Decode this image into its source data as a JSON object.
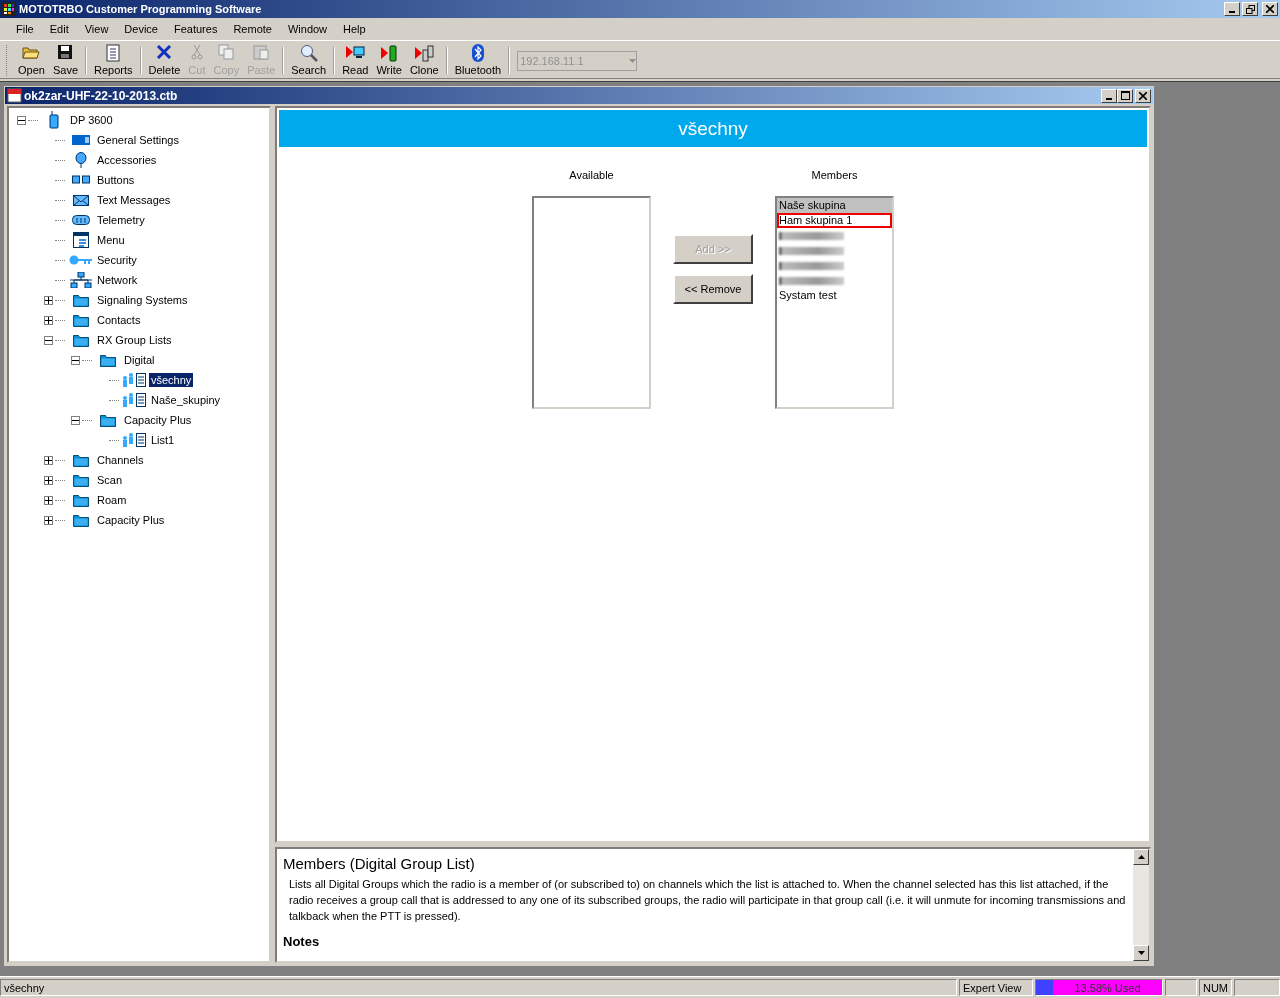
{
  "window": {
    "title": "MOTOTRBO Customer Programming Software"
  },
  "menu": [
    "File",
    "Edit",
    "View",
    "Device",
    "Features",
    "Remote",
    "Window",
    "Help"
  ],
  "toolbar": [
    {
      "kind": "open",
      "label": "Open",
      "disabled": false
    },
    {
      "kind": "save",
      "label": "Save",
      "disabled": false
    },
    {
      "kind": "reports",
      "label": "Reports",
      "disabled": false
    },
    {
      "kind": "delete",
      "label": "Delete",
      "disabled": false
    },
    {
      "kind": "cut",
      "label": "Cut",
      "disabled": true
    },
    {
      "kind": "copy",
      "label": "Copy",
      "disabled": true
    },
    {
      "kind": "paste",
      "label": "Paste",
      "disabled": true
    },
    {
      "kind": "search",
      "label": "Search",
      "disabled": false
    },
    {
      "kind": "read",
      "label": "Read",
      "disabled": false
    },
    {
      "kind": "write",
      "label": "Write",
      "disabled": false
    },
    {
      "kind": "clone",
      "label": "Clone",
      "disabled": false
    },
    {
      "kind": "bluetooth",
      "label": "Bluetooth",
      "disabled": false
    }
  ],
  "address_field": {
    "value": "192.168.11.1",
    "disabled": true
  },
  "document": {
    "title": "ok2zar-UHF-22-10-2013.ctb"
  },
  "tree": [
    {
      "kind": "radio",
      "label": "DP 3600",
      "expanded": true,
      "selected": false,
      "children": [
        {
          "kind": "settings",
          "label": "General Settings",
          "selected": false
        },
        {
          "kind": "accessories",
          "label": "Accessories",
          "selected": false
        },
        {
          "kind": "buttons",
          "label": "Buttons",
          "selected": false
        },
        {
          "kind": "messages",
          "label": "Text Messages",
          "selected": false
        },
        {
          "kind": "telemetry",
          "label": "Telemetry",
          "selected": false
        },
        {
          "kind": "menu",
          "label": "Menu",
          "selected": false
        },
        {
          "kind": "key",
          "label": "Security",
          "selected": false
        },
        {
          "kind": "network",
          "label": "Network",
          "selected": false
        },
        {
          "kind": "folder",
          "label": "Signaling Systems",
          "expanded": false,
          "selected": false
        },
        {
          "kind": "folder",
          "label": "Contacts",
          "expanded": false,
          "selected": false
        },
        {
          "kind": "folder",
          "label": "RX Group Lists",
          "expanded": true,
          "selected": false,
          "children": [
            {
              "kind": "folder",
              "label": "Digital",
              "expanded": true,
              "selected": false,
              "children": [
                {
                  "kind": "group",
                  "label": "všechny",
                  "selected": true
                },
                {
                  "kind": "group",
                  "label": "Naše_skupiny",
                  "selected": false
                }
              ]
            },
            {
              "kind": "folder",
              "label": "Capacity Plus",
              "expanded": true,
              "selected": false,
              "children": [
                {
                  "kind": "group",
                  "label": "List1",
                  "selected": false
                }
              ]
            }
          ]
        },
        {
          "kind": "folder",
          "label": "Channels",
          "expanded": false,
          "selected": false
        },
        {
          "kind": "folder",
          "label": "Scan",
          "expanded": false,
          "selected": false
        },
        {
          "kind": "folder",
          "label": "Roam",
          "expanded": false,
          "selected": false
        },
        {
          "kind": "folder",
          "label": "Capacity Plus",
          "expanded": false,
          "selected": false
        }
      ]
    }
  ],
  "editor": {
    "title": "všechny",
    "available_label": "Available",
    "members_label": "Members",
    "buttons": [
      {
        "label": "Add >>",
        "disabled": true
      },
      {
        "label": "<< Remove",
        "disabled": false
      }
    ],
    "members": [
      {
        "kind": "text",
        "label": "Naše skupina",
        "selected": true,
        "highlighted": false
      },
      {
        "kind": "text",
        "label": "Ham skupina 1",
        "selected": false,
        "highlighted": true
      },
      {
        "kind": "blurred",
        "selected": false,
        "highlighted": false
      },
      {
        "kind": "blurred",
        "selected": false,
        "highlighted": false
      },
      {
        "kind": "blurred",
        "selected": false,
        "highlighted": false
      },
      {
        "kind": "blurred",
        "selected": false,
        "highlighted": false
      },
      {
        "kind": "text",
        "label": "Systam test",
        "selected": false,
        "highlighted": false
      }
    ]
  },
  "help": {
    "title": "Members (Digital Group List)",
    "body": "Lists all Digital Groups which the radio is a member of (or subscribed to) on channels which the list is attached to. When the channel selected has this list attached, if the radio receives a group call that is addressed to any one of its subscribed groups, the radio will participate in that group call (i.e. it will unmute for incoming transmissions and talkback when the PTT is pressed).",
    "notes_title": "Notes"
  },
  "status_bar": {
    "text": "všechny",
    "view": "Expert View",
    "usage": {
      "label": "13.58% Used",
      "level": 0.1358
    },
    "num": "NUM"
  }
}
